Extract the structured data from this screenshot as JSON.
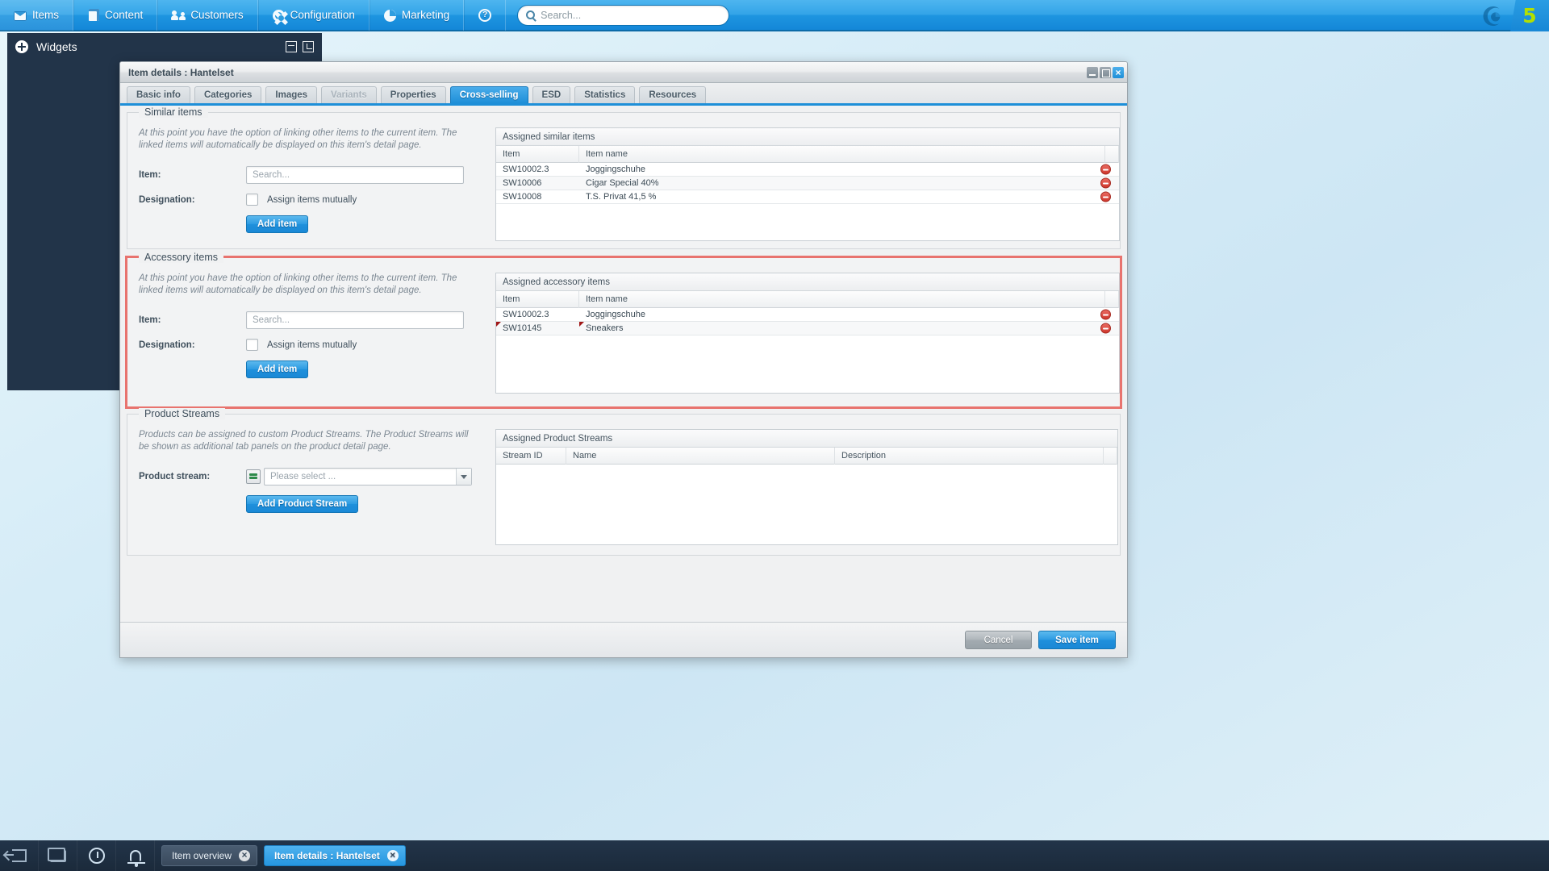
{
  "topbar": {
    "menu": [
      {
        "label": "Items",
        "icon": "items-icon"
      },
      {
        "label": "Content",
        "icon": "content-icon"
      },
      {
        "label": "Customers",
        "icon": "customers-icon"
      },
      {
        "label": "Configuration",
        "icon": "gear-icon"
      },
      {
        "label": "Marketing",
        "icon": "pie-chart-icon"
      }
    ],
    "help_icon": "help-icon",
    "search": {
      "placeholder": "Search...",
      "value": "",
      "icon": "search-icon"
    },
    "brand": {
      "logo": "shopware-logo-icon",
      "version_badge": "5"
    }
  },
  "widgets_panel": {
    "title": "Widgets",
    "add_icon": "plus-circle-icon",
    "minimize_icon": "minimize-icon",
    "popout_icon": "popout-icon"
  },
  "dialog": {
    "title": "Item details : Hantelset",
    "window_buttons": {
      "minimize": "minimize-icon",
      "maximize": "maximize-icon",
      "close": "close-icon"
    },
    "tabs": [
      {
        "label": "Basic info",
        "state": "normal"
      },
      {
        "label": "Categories",
        "state": "normal"
      },
      {
        "label": "Images",
        "state": "normal"
      },
      {
        "label": "Variants",
        "state": "disabled"
      },
      {
        "label": "Properties",
        "state": "normal"
      },
      {
        "label": "Cross-selling",
        "state": "active"
      },
      {
        "label": "ESD",
        "state": "normal"
      },
      {
        "label": "Statistics",
        "state": "normal"
      },
      {
        "label": "Resources",
        "state": "normal"
      }
    ],
    "similar_items": {
      "legend": "Similar items",
      "hint": "At this point you have the option of linking other items to the current item. The linked items will automatically be displayed on this item's detail page.",
      "item_label": "Item:",
      "item_placeholder": "Search...",
      "item_value": "",
      "designation_label": "Designation:",
      "mutual_label": "Assign items mutually",
      "mutual_checked": false,
      "add_button": "Add item",
      "grid": {
        "caption": "Assigned similar items",
        "columns": [
          "Item",
          "Item name"
        ],
        "rows": [
          {
            "item": "SW10002.3",
            "name": "Joggingschuhe",
            "dirty": false
          },
          {
            "item": "SW10006",
            "name": "Cigar Special 40%",
            "dirty": false
          },
          {
            "item": "SW10008",
            "name": "T.S. Privat 41,5 %",
            "dirty": false
          }
        ]
      }
    },
    "accessory_items": {
      "legend": "Accessory items",
      "highlighted": true,
      "highlight_color": "#e8736e",
      "hint": "At this point you have the option of linking other items to the current item. The linked items will automatically be displayed on this item's detail page.",
      "item_label": "Item:",
      "item_placeholder": "Search...",
      "item_value": "",
      "designation_label": "Designation:",
      "mutual_label": "Assign items mutually",
      "mutual_checked": false,
      "add_button": "Add item",
      "grid": {
        "caption": "Assigned accessory items",
        "columns": [
          "Item",
          "Item name"
        ],
        "rows": [
          {
            "item": "SW10002.3",
            "name": "Joggingschuhe",
            "dirty": false
          },
          {
            "item": "SW10145",
            "name": "Sneakers",
            "dirty": true
          }
        ]
      }
    },
    "product_streams": {
      "legend": "Product Streams",
      "hint": "Products can be assigned to custom Product Streams. The Product Streams will be shown as additional tab panels on the product detail page.",
      "stream_label": "Product stream:",
      "stream_placeholder": "Please select ...",
      "stream_value": "",
      "stream_icon": "product-stream-icon",
      "add_button": "Add Product Stream",
      "grid": {
        "caption": "Assigned Product Streams",
        "columns": [
          "Stream ID",
          "Name",
          "Description"
        ],
        "rows": []
      }
    },
    "footer": {
      "cancel": "Cancel",
      "save": "Save item"
    }
  },
  "taskbar": {
    "system_icons": [
      "logout-icon",
      "windows-icon",
      "clock-icon",
      "bell-icon"
    ],
    "tasks": [
      {
        "label": "Item overview",
        "active": false
      },
      {
        "label": "Item details : Hantelset",
        "active": true
      }
    ]
  }
}
